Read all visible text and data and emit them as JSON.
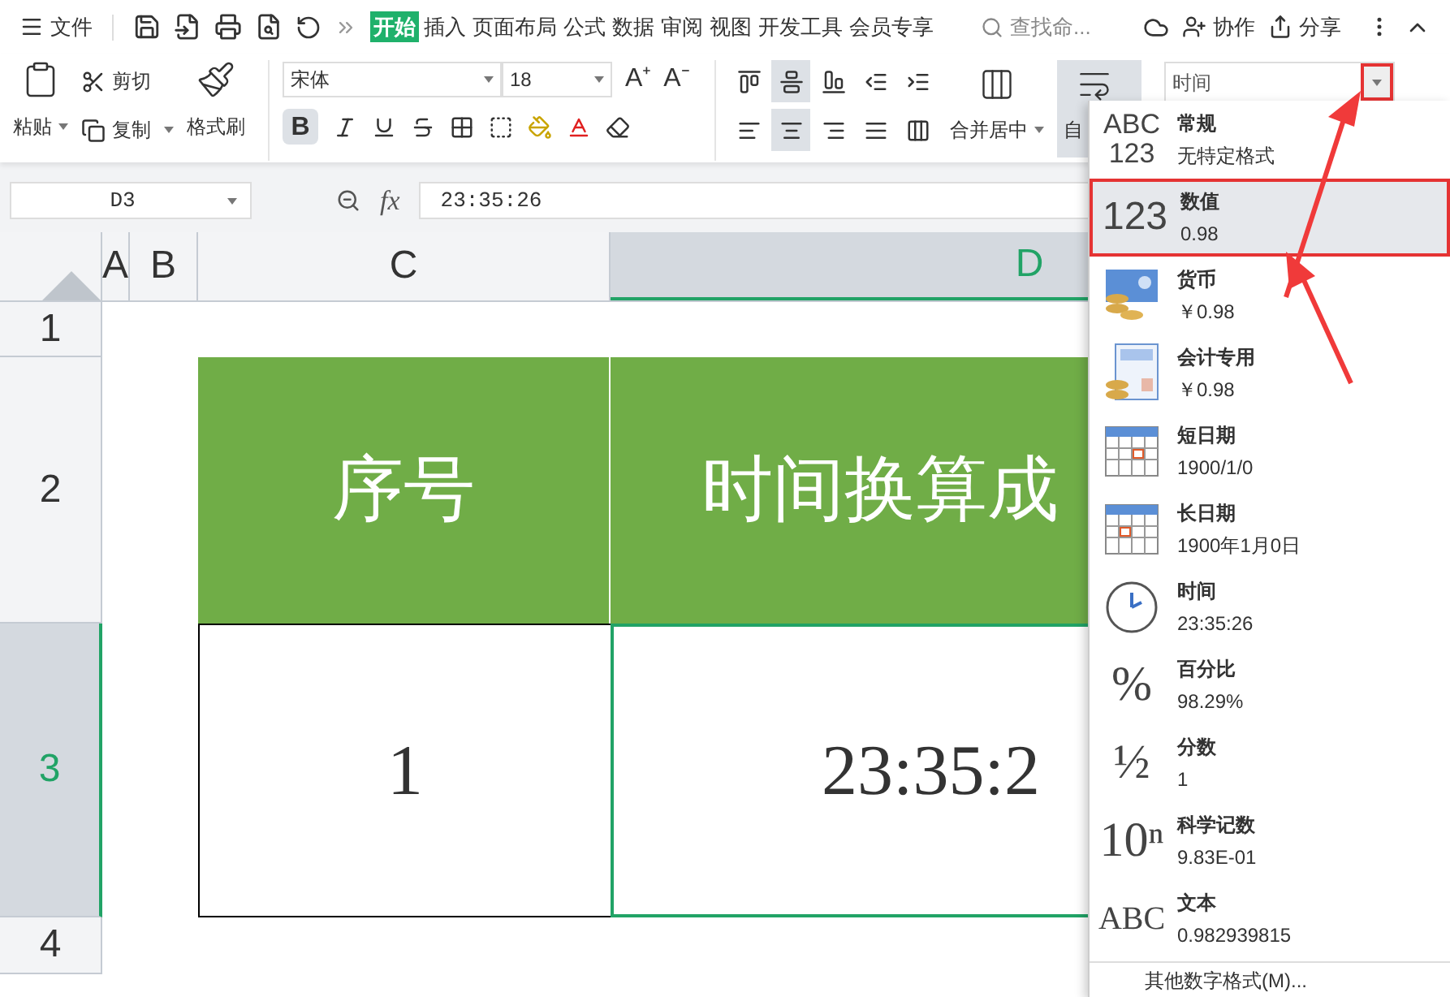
{
  "menu_bar": {
    "file_menu": "文件",
    "tabs": [
      {
        "label": "开始",
        "selected": true
      },
      {
        "label": "插入",
        "selected": false
      },
      {
        "label": "页面布局",
        "selected": false
      },
      {
        "label": "公式",
        "selected": false
      },
      {
        "label": "数据",
        "selected": false
      },
      {
        "label": "审阅",
        "selected": false
      },
      {
        "label": "视图",
        "selected": false
      },
      {
        "label": "开发工具",
        "selected": false
      },
      {
        "label": "会员专享",
        "selected": false
      }
    ],
    "search": {
      "placeholder": "查找命..."
    },
    "collaborate": "协作",
    "share": "分享"
  },
  "ribbon": {
    "paste": "粘贴",
    "cut": "剪切",
    "copy": "复制",
    "format_painter": "格式刷",
    "font": "宋体",
    "font_size": "18",
    "grow_font": "A⁺",
    "shrink_font": "A⁻",
    "bold_label": "B",
    "bold": true,
    "align_top": [
      {
        "kind": "top",
        "selected": false
      },
      {
        "kind": "middle",
        "selected": true
      },
      {
        "kind": "bottom",
        "selected": false
      },
      {
        "kind": "outdent",
        "selected": false
      },
      {
        "kind": "indent",
        "selected": false
      }
    ],
    "align_bottom": [
      {
        "kind": "left",
        "selected": false
      },
      {
        "kind": "center",
        "selected": true
      },
      {
        "kind": "right",
        "selected": false
      },
      {
        "kind": "justify",
        "selected": false
      },
      {
        "kind": "distributed",
        "selected": false
      }
    ],
    "merge": "合并居中",
    "wrap": "自",
    "number_format": "时间"
  },
  "formula_bar": {
    "cell": "D3",
    "fx": "fx",
    "value": "23:35:26"
  },
  "sheet": {
    "columns": [
      {
        "label": "A",
        "selected": false
      },
      {
        "label": "B",
        "selected": false
      },
      {
        "label": "C",
        "selected": false
      },
      {
        "label": "D",
        "selected": true
      }
    ],
    "rows": [
      {
        "label": "1",
        "selected": false
      },
      {
        "label": "2",
        "selected": false
      },
      {
        "label": "3",
        "selected": true
      },
      {
        "label": "4",
        "selected": false
      }
    ],
    "header_cells": [
      "序号",
      "时间换算成"
    ],
    "data_cells": [
      "1",
      "23:35:2"
    ]
  },
  "format_menu": {
    "items": [
      {
        "kind": "general",
        "glyph": "ABC\n123",
        "name": "常规",
        "example": "无特定格式",
        "selected": false
      },
      {
        "kind": "number",
        "glyph": "123",
        "name": "数值",
        "example": "0.98",
        "selected": true
      },
      {
        "kind": "currency",
        "name": "货币",
        "example": "￥0.98",
        "selected": false
      },
      {
        "kind": "accounting",
        "name": "会计专用",
        "example": "￥0.98",
        "selected": false
      },
      {
        "kind": "short_date",
        "name": "短日期",
        "example": "1900/1/0",
        "selected": false
      },
      {
        "kind": "long_date",
        "name": "长日期",
        "example": "1900年1月0日",
        "selected": false
      },
      {
        "kind": "time",
        "name": "时间",
        "example": "23:35:26",
        "selected": false
      },
      {
        "kind": "percent",
        "glyph": "%",
        "name": "百分比",
        "example": "98.29%",
        "selected": false
      },
      {
        "kind": "fraction",
        "glyph": "½",
        "name": "分数",
        "example": "1",
        "selected": false
      },
      {
        "kind": "scientific",
        "glyph": "10ⁿ",
        "name": "科学记数",
        "example": "9.83E-01",
        "selected": false
      },
      {
        "kind": "text",
        "glyph": "ABC",
        "name": "文本",
        "example": "0.982939815",
        "selected": false
      }
    ],
    "more": "其他数字格式(M)..."
  }
}
